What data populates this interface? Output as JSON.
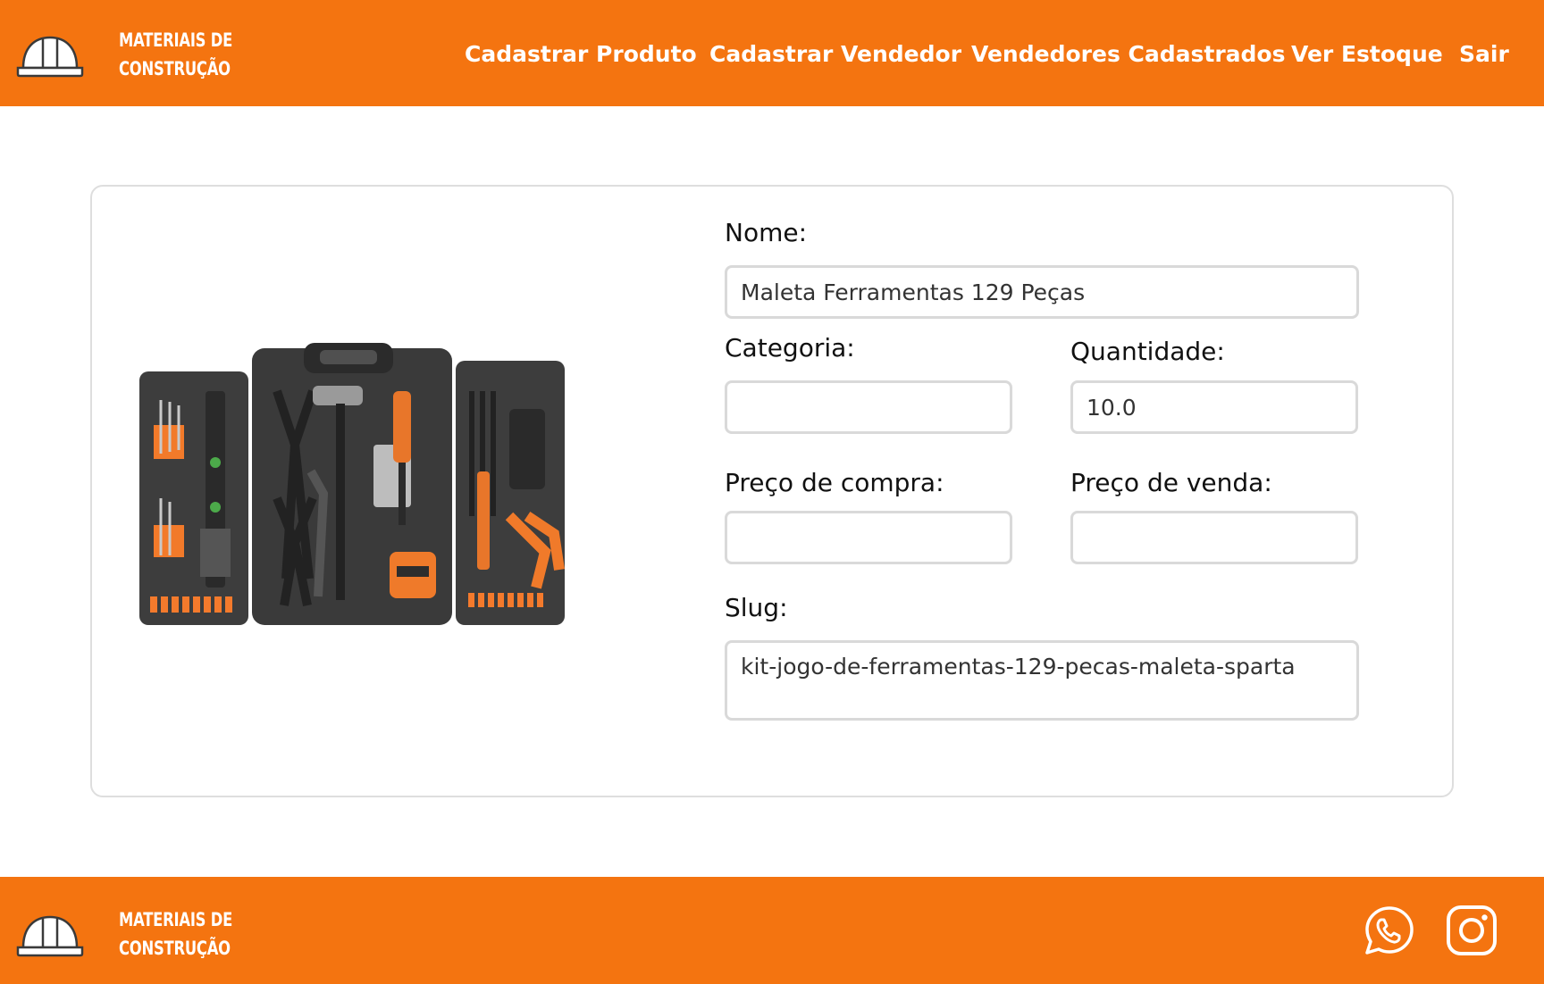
{
  "header": {
    "brand_line1": "MATERIAIS DE",
    "brand_line2": "CONSTRUÇÃO",
    "logo_icon": "hard-hat-icon",
    "nav": [
      {
        "label": "Cadastrar Produto"
      },
      {
        "label": "Cadastrar Vendedor"
      },
      {
        "label": "Vendedores Cadastrados"
      },
      {
        "label": "Ver Estoque"
      },
      {
        "label": "Sair"
      }
    ]
  },
  "product": {
    "image_alt": "Maleta Ferramentas 129 Peças",
    "name_label": "Nome:",
    "name_value": "Maleta Ferramentas 129 Peças",
    "category_label": "Categoria:",
    "category_value": "",
    "quantity_label": "Quantidade:",
    "quantity_value": "10.0",
    "buy_price_label": "Preço de compra:",
    "buy_price_value": "",
    "sell_price_label": "Preço de venda:",
    "sell_price_value": "",
    "slug_label": "Slug:",
    "slug_value": "kit-jogo-de-ferramentas-129-pecas-maleta-sparta"
  },
  "footer": {
    "brand_line1": "MATERIAIS DE",
    "brand_line2": "CONSTRUÇÃO",
    "social": [
      {
        "icon": "whatsapp-icon"
      },
      {
        "icon": "instagram-icon"
      }
    ]
  },
  "colors": {
    "brand_orange": "#F47410",
    "border_gray": "#D9D9D9",
    "white": "#FFFFFF"
  }
}
